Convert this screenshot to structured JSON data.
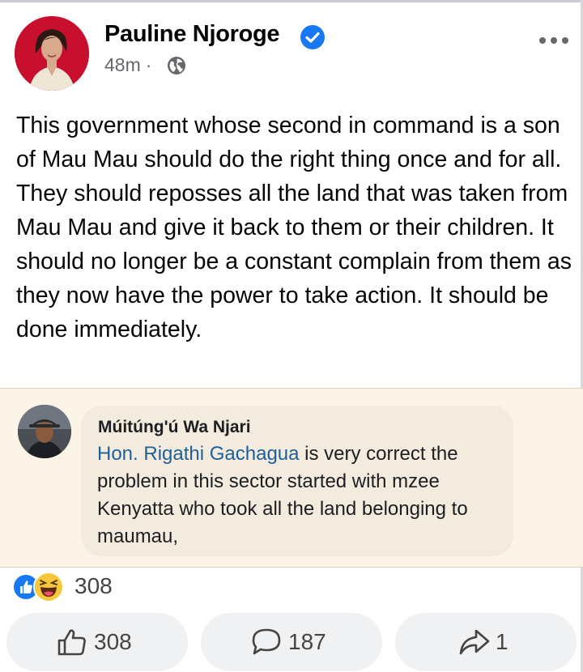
{
  "post": {
    "author": "Pauline Njoroge",
    "time": "48m",
    "separator": "·",
    "text": "This government whose second in command is a son of Mau Mau should do the right thing once and for all. They should reposses all the land that was taken from Mau Mau and give it back to them or their children. It should no longer be a constant complain from them as they now have the power to take action. It should be done immediately."
  },
  "shared_comment": {
    "author": "Múitúng'ú Wa Njari",
    "mention": "Hon. Rigathi Gachagua",
    "text": " is very correct the problem in this sector started with mzee Kenyatta who took all the land belonging to maumau,"
  },
  "reactions": {
    "icons": [
      "like-icon",
      "haha-icon"
    ],
    "count": "308"
  },
  "actions": {
    "like_count": "308",
    "comment_count": "187",
    "share_count": "1"
  },
  "colors": {
    "accent": "#1877f2",
    "shared_background": "#fcf4e6",
    "mention": "#1f5f9a"
  }
}
